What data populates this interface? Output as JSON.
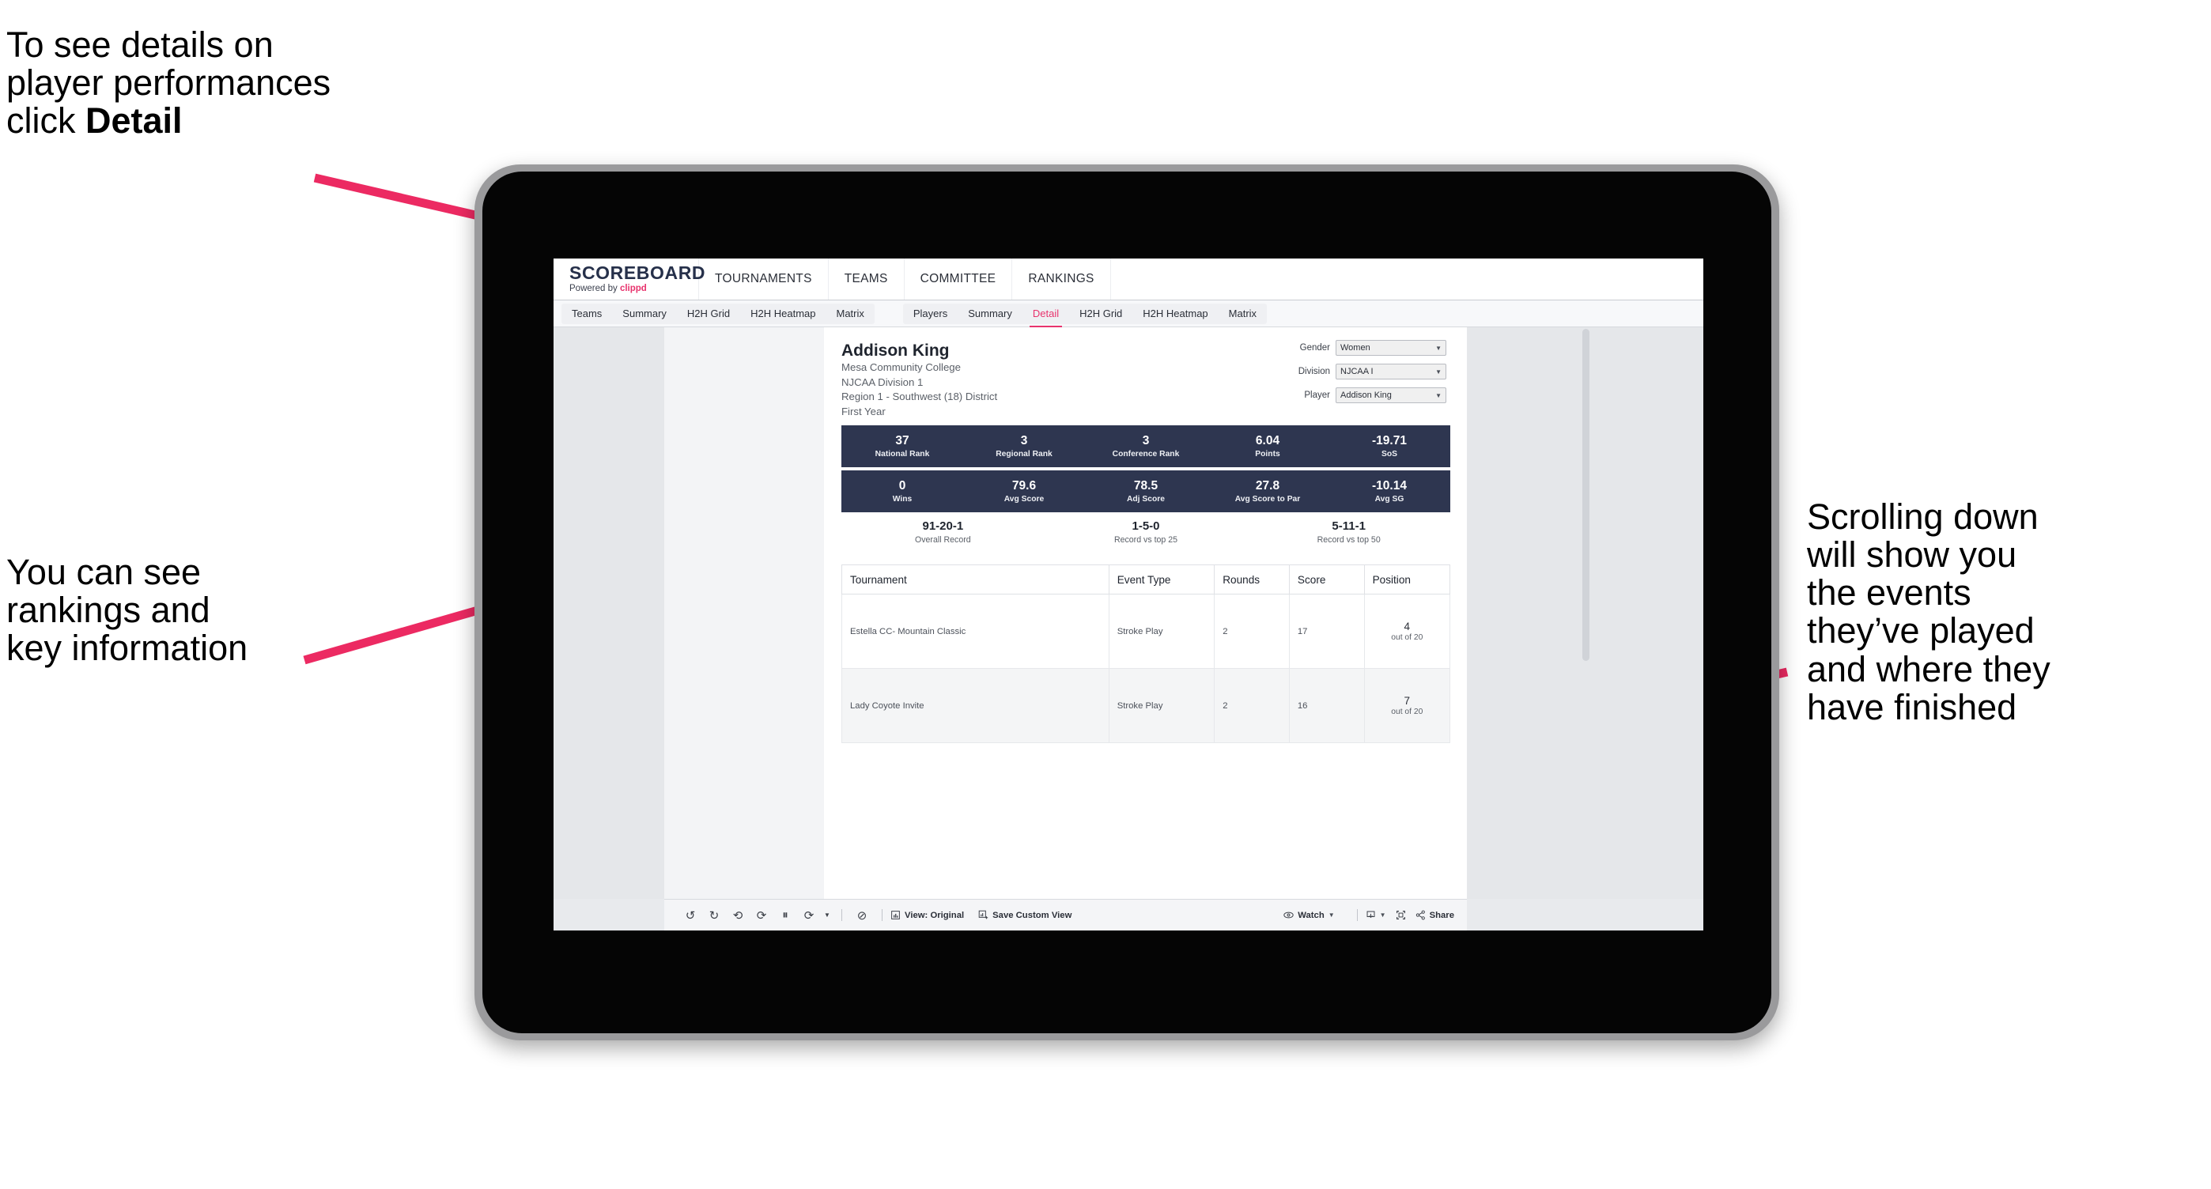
{
  "annotations": {
    "left_top": "To see details on\nplayer performances\nclick ",
    "left_top_bold": "Detail",
    "left_bottom": "You can see\nrankings and\nkey information",
    "right": "Scrolling down\nwill show you\nthe events\nthey’ve played\nand where they\nhave finished"
  },
  "app": {
    "brand": {
      "title": "SCOREBOARD",
      "powered_prefix": "Powered by ",
      "powered_name": "clippd"
    },
    "topnav": [
      "TOURNAMENTS",
      "TEAMS",
      "COMMITTEE",
      "RANKINGS"
    ],
    "tabs_left": [
      "Teams",
      "Summary",
      "H2H Grid",
      "H2H Heatmap",
      "Matrix"
    ],
    "tabs_right": [
      "Players",
      "Summary",
      "Detail",
      "H2H Grid",
      "H2H Heatmap",
      "Matrix"
    ],
    "active_tab": "Detail"
  },
  "player": {
    "name": "Addison King",
    "meta": [
      "Mesa Community College",
      "NJCAA Division 1",
      "Region 1 - Southwest (18) District",
      "First Year"
    ]
  },
  "filters": [
    {
      "label": "Gender",
      "value": "Women"
    },
    {
      "label": "Division",
      "value": "NJCAA I"
    },
    {
      "label": "Player",
      "value": "Addison King"
    }
  ],
  "stats_row1": [
    {
      "value": "37",
      "label": "National Rank"
    },
    {
      "value": "3",
      "label": "Regional Rank"
    },
    {
      "value": "3",
      "label": "Conference Rank"
    },
    {
      "value": "6.04",
      "label": "Points"
    },
    {
      "value": "-19.71",
      "label": "SoS"
    }
  ],
  "stats_row2": [
    {
      "value": "0",
      "label": "Wins"
    },
    {
      "value": "79.6",
      "label": "Avg Score"
    },
    {
      "value": "78.5",
      "label": "Adj Score"
    },
    {
      "value": "27.8",
      "label": "Avg Score to Par"
    },
    {
      "value": "-10.14",
      "label": "Avg SG"
    }
  ],
  "records": [
    {
      "value": "91-20-1",
      "label": "Overall Record"
    },
    {
      "value": "1-5-0",
      "label": "Record vs top 25"
    },
    {
      "value": "5-11-1",
      "label": "Record vs top 50"
    }
  ],
  "table": {
    "headers": [
      "Tournament",
      "Event Type",
      "Rounds",
      "Score",
      "Position"
    ],
    "rows": [
      {
        "tournament": "Estella CC- Mountain Classic",
        "event_type": "Stroke Play",
        "rounds": "2",
        "score": "17",
        "position": "4",
        "position_sub": "out of 20"
      },
      {
        "tournament": "Lady Coyote Invite",
        "event_type": "Stroke Play",
        "rounds": "2",
        "score": "16",
        "position": "7",
        "position_sub": "out of 20"
      }
    ]
  },
  "toolbar": {
    "view_label": "View: Original",
    "save_label": "Save Custom View",
    "watch_label": "Watch",
    "share_label": "Share"
  },
  "colors": {
    "accent_pink": "#e8336d",
    "stat_navy": "#2e3650",
    "canvas_gray": "#e5e7ea"
  }
}
